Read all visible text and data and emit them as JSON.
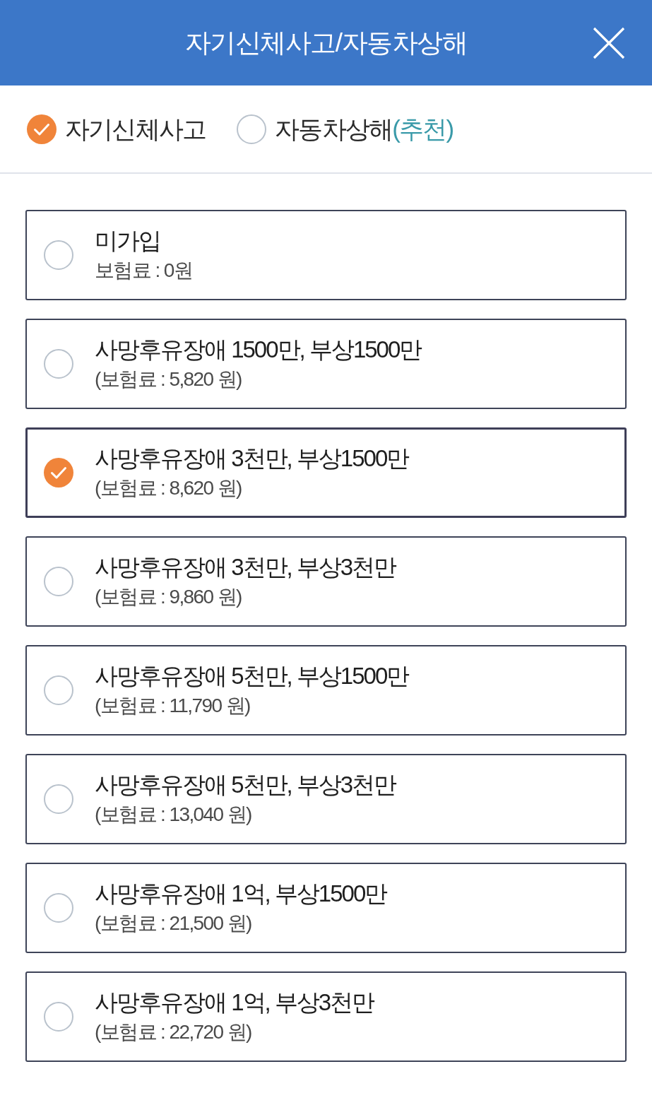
{
  "header": {
    "title": "자기신체사고/자동차상해"
  },
  "coverage_types": [
    {
      "label": "자기신체사고",
      "selected": true
    },
    {
      "label": "자동차상해",
      "tag": "(추천)",
      "selected": false
    }
  ],
  "options": [
    {
      "title": "미가입",
      "premium": "보험료 : 0원",
      "selected": false
    },
    {
      "title": "사망후유장애 1500만, 부상1500만",
      "premium": "(보험료 : 5,820 원)",
      "selected": false
    },
    {
      "title": "사망후유장애 3천만, 부상1500만",
      "premium": "(보험료 : 8,620 원)",
      "selected": true
    },
    {
      "title": "사망후유장애 3천만, 부상3천만",
      "premium": "(보험료 : 9,860 원)",
      "selected": false
    },
    {
      "title": "사망후유장애 5천만, 부상1500만",
      "premium": "(보험료 : 11,790 원)",
      "selected": false
    },
    {
      "title": "사망후유장애 5천만, 부상3천만",
      "premium": "(보험료 : 13,040 원)",
      "selected": false
    },
    {
      "title": "사망후유장애 1억, 부상1500만",
      "premium": "(보험료 : 21,500 원)",
      "selected": false
    },
    {
      "title": "사망후유장애 1억, 부상3천만",
      "premium": "(보험료 : 22,720 원)",
      "selected": false
    }
  ]
}
